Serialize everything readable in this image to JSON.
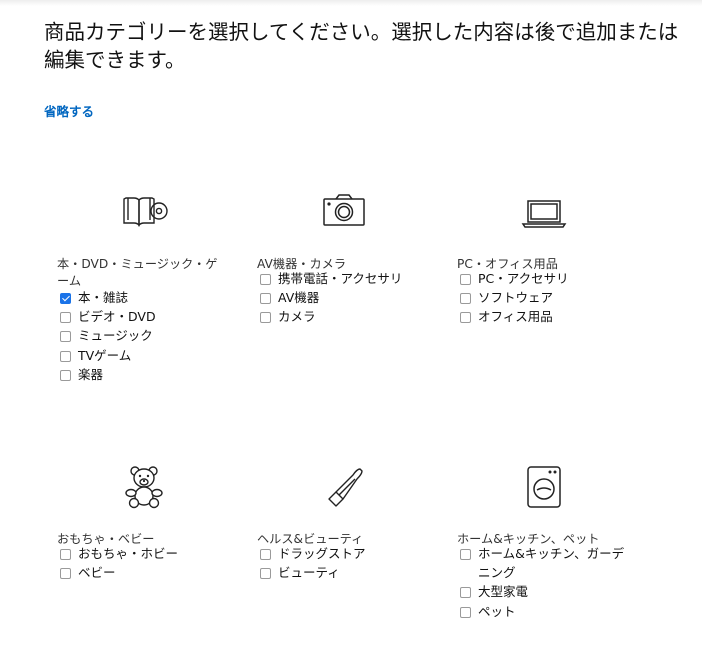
{
  "page": {
    "title": "商品カテゴリーを選択してください。選択した内容は後で追加または編集できます。",
    "skip_label": "省略する"
  },
  "categories": [
    {
      "name": "本・DVD・ミュージック・ゲーム",
      "icon": "book-disc-icon",
      "options": [
        {
          "label": "本・雑誌",
          "checked": true
        },
        {
          "label": "ビデオ・DVD",
          "checked": false
        },
        {
          "label": "ミュージック",
          "checked": false
        },
        {
          "label": "TVゲーム",
          "checked": false
        },
        {
          "label": "楽器",
          "checked": false
        }
      ]
    },
    {
      "name": "AV機器・カメラ",
      "icon": "camera-icon",
      "options": [
        {
          "label": "携帯電話・アクセサリ",
          "checked": false
        },
        {
          "label": "AV機器",
          "checked": false
        },
        {
          "label": "カメラ",
          "checked": false
        }
      ]
    },
    {
      "name": "PC・オフィス用品",
      "icon": "laptop-icon",
      "options": [
        {
          "label": "PC・アクセサリ",
          "checked": false
        },
        {
          "label": "ソフトウェア",
          "checked": false
        },
        {
          "label": "オフィス用品",
          "checked": false
        }
      ]
    },
    {
      "name": "おもちゃ・ベビー",
      "icon": "teddy-bear-icon",
      "options": [
        {
          "label": "おもちゃ・ホビー",
          "checked": false
        },
        {
          "label": "ベビー",
          "checked": false
        }
      ]
    },
    {
      "name": "ヘルス&ビューティ",
      "icon": "lipstick-icon",
      "options": [
        {
          "label": "ドラッグストア",
          "checked": false
        },
        {
          "label": "ビューティ",
          "checked": false
        }
      ]
    },
    {
      "name": "ホーム&キッチン、ペット",
      "icon": "washing-machine-icon",
      "options": [
        {
          "label": "ホーム&キッチン、ガーデニング",
          "checked": false
        },
        {
          "label": "大型家電",
          "checked": false
        },
        {
          "label": "ペット",
          "checked": false
        }
      ]
    }
  ]
}
